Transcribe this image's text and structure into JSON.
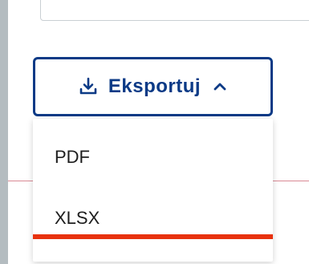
{
  "export_button": {
    "label": "Eksportuj",
    "icon": "download-icon",
    "chevron": "chevron-up-icon",
    "expanded": true
  },
  "dropdown": {
    "items": [
      {
        "label": "PDF"
      },
      {
        "label": "XLSX",
        "focused": true
      }
    ]
  },
  "colors": {
    "primary": "#0b3a86",
    "focus_underline": "#e8320e",
    "divider": "#d98a95",
    "outer_background": "#b4bcc0"
  }
}
